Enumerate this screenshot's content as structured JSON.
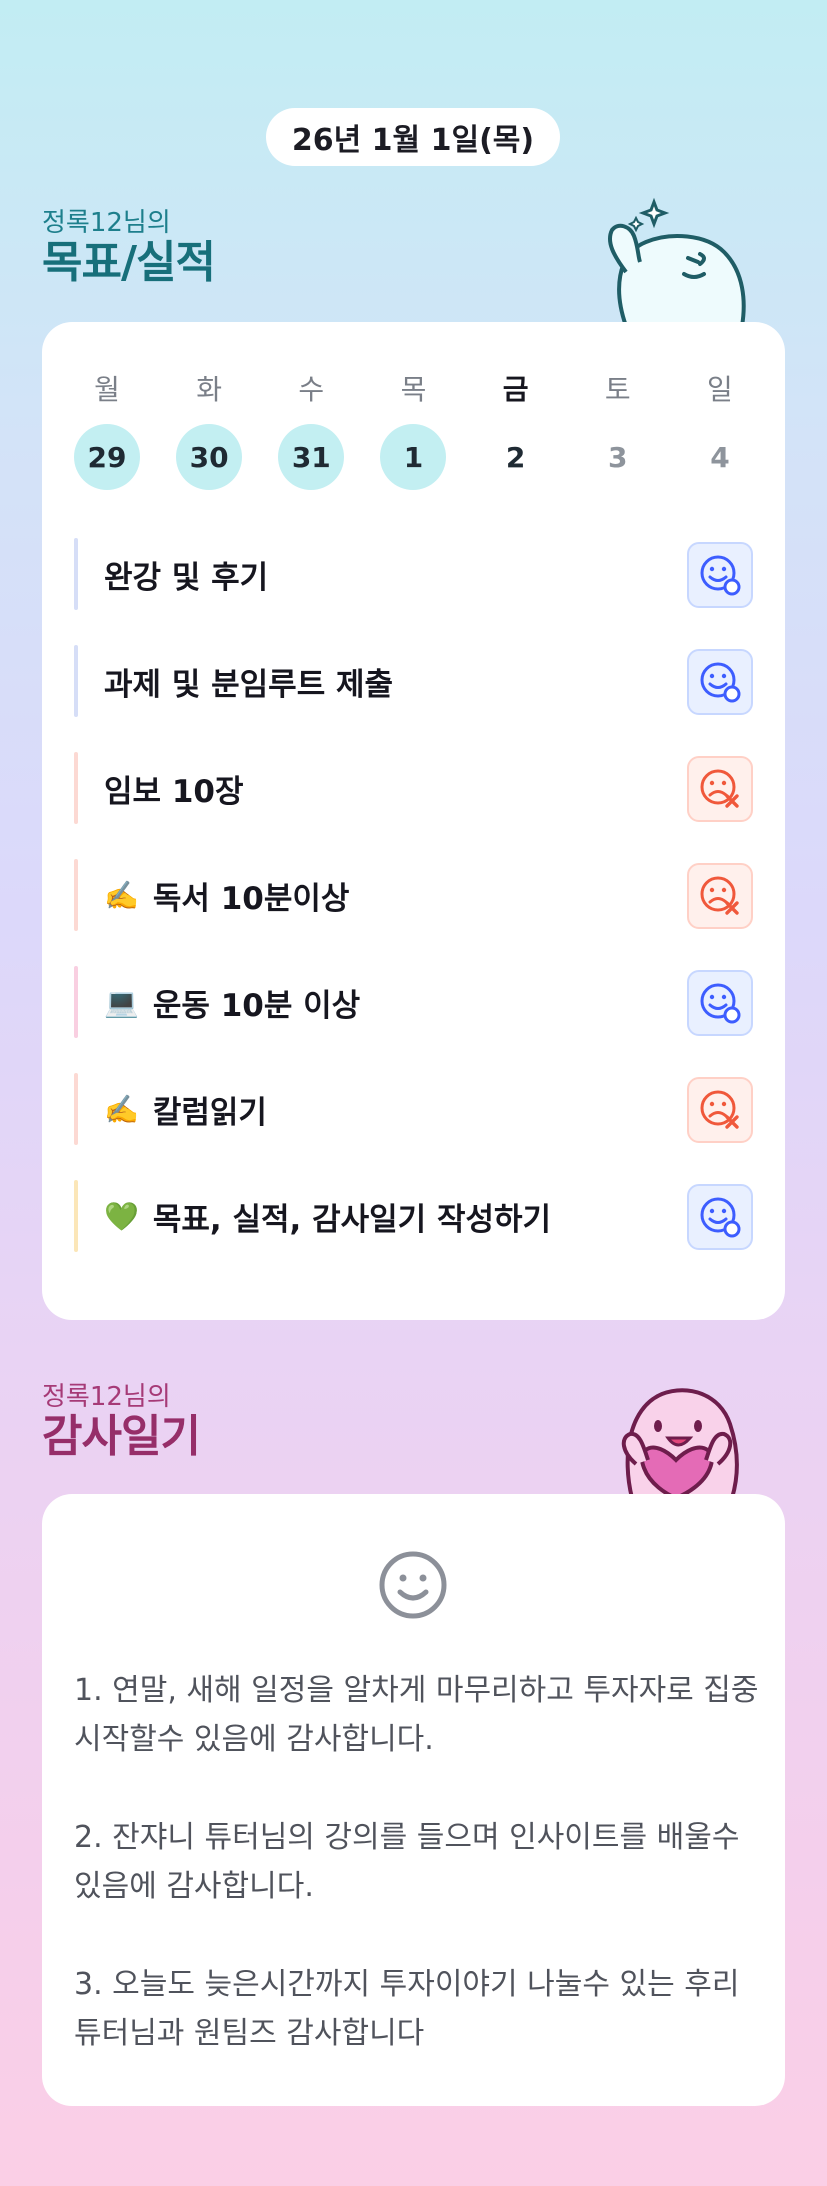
{
  "date": "26년 1월 1일(목)",
  "goal_section": {
    "subtitle": "정록12님의",
    "title": "목표/실적"
  },
  "gratitude_section": {
    "subtitle": "정록12님의",
    "title": "감사일기"
  },
  "week": [
    {
      "name": "월",
      "num": "29",
      "state": "done"
    },
    {
      "name": "화",
      "num": "30",
      "state": "done"
    },
    {
      "name": "수",
      "num": "31",
      "state": "done"
    },
    {
      "name": "목",
      "num": "1",
      "state": "done"
    },
    {
      "name": "금",
      "num": "2",
      "state": "today"
    },
    {
      "name": "토",
      "num": "3",
      "state": "future"
    },
    {
      "name": "일",
      "num": "4",
      "state": "future"
    }
  ],
  "tasks": [
    {
      "emoji": "",
      "label": "완강 및 후기",
      "status": "success",
      "bar_color": "#d6def7"
    },
    {
      "emoji": "",
      "label": "과제 및 분임루트 제출",
      "status": "success",
      "bar_color": "#d6def7"
    },
    {
      "emoji": "",
      "label": "임보 10장",
      "status": "fail",
      "bar_color": "#fcd9d3"
    },
    {
      "emoji": "✍️",
      "label": "독서 10분이상",
      "status": "fail",
      "bar_color": "#fcd9d3"
    },
    {
      "emoji": "💻",
      "label": "운동 10분 이상",
      "status": "success",
      "bar_color": "#f9cfe1"
    },
    {
      "emoji": "✍️",
      "label": "칼럼읽기",
      "status": "fail",
      "bar_color": "#fcd9d3"
    },
    {
      "emoji": "💚",
      "label": "목표, 실적, 감사일기 작성하기",
      "status": "success",
      "bar_color": "#fbe6b8"
    }
  ],
  "gratitude_entries": [
    "1. 연말, 새해 일정을 알차게 마무리하고 투자자로 집중 시작할수 있음에 감사합니다.",
    "2. 잔쟈니 튜터님의 강의를 들으며 인사이트를 배울수 있음에 감사합니다.",
    "3. 오늘도 늦은시간까지 투자이야기 나눌수 있는 후리튜터님과 원팀즈 감사합니다"
  ],
  "colors": {
    "success": "#3d5dff",
    "fail": "#f0583b"
  },
  "icons": {
    "success": "happy-face-check-icon",
    "fail": "sad-face-x-icon",
    "gratitude": "smiley-face-icon"
  }
}
